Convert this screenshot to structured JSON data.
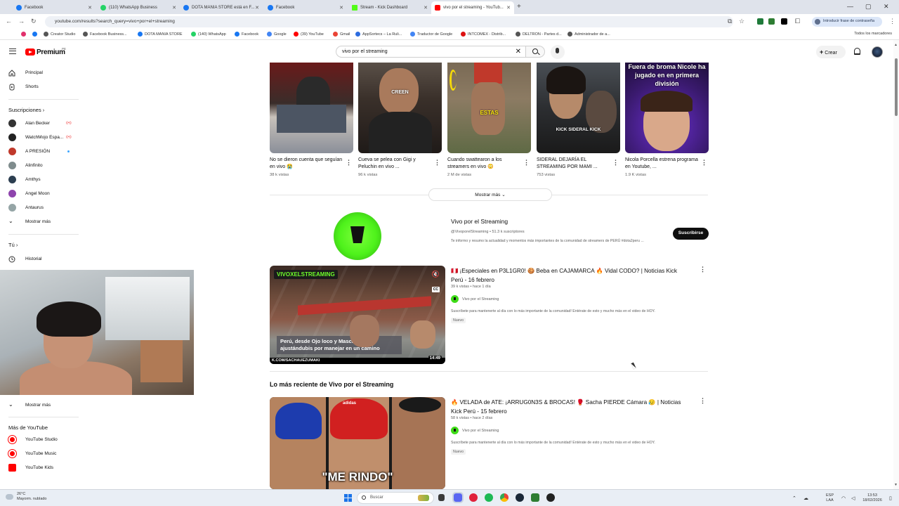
{
  "browser": {
    "tabs": [
      {
        "label": "Facebook",
        "color": "#1877f2"
      },
      {
        "label": "(110) WhatsApp Business",
        "color": "#25d366"
      },
      {
        "label": "DOTA MANIA STORE está en F...",
        "color": "#1877f2"
      },
      {
        "label": "Facebook",
        "color": "#1877f2"
      },
      {
        "label": "Stream - Kick Dashboard",
        "color": "#53fc18"
      },
      {
        "label": "vivo por el streaming - YouTub...",
        "color": "#ff0000",
        "active": true
      }
    ],
    "url": "youtube.com/results?search_query=vivo+por+el+streaming",
    "password_prompt": "Introducir frase de contraseña",
    "bookmarks": [
      {
        "label": "",
        "color": "#e1306c"
      },
      {
        "label": "",
        "color": "#1877f2"
      },
      {
        "label": "Creator Studio",
        "color": "#555"
      },
      {
        "label": "Facebook Business...",
        "color": "#555"
      },
      {
        "label": "DOTA MANIA STORE",
        "color": "#1877f2"
      },
      {
        "label": "(140) WhatsApp",
        "color": "#25d366"
      },
      {
        "label": "Facebook",
        "color": "#1877f2"
      },
      {
        "label": "Google",
        "color": "#4285f4"
      },
      {
        "label": "(39) YouTube",
        "color": "#ff0000"
      },
      {
        "label": "Gmail",
        "color": "#ea4335"
      },
      {
        "label": "AppSortecs – La Ruli...",
        "color": "#2d6cdf"
      },
      {
        "label": "Traductor de Google",
        "color": "#4285f4"
      },
      {
        "label": "INTCOMEX - Distrib...",
        "color": "#d11"
      },
      {
        "label": "DELTRON - Partes d...",
        "color": "#555"
      },
      {
        "label": "Administrador de a...",
        "color": "#555"
      }
    ],
    "all_bookmarks": "Todos los marcadores"
  },
  "youtube": {
    "brand": "Premium",
    "country": "PE",
    "search_query": "vivo por el streaming",
    "create_label": "Crear",
    "sidebar": {
      "home": "Principal",
      "shorts": "Shorts",
      "subscriptions_title": "Suscripciones",
      "subscriptions": [
        {
          "name": "Alan Becker",
          "color": "#333",
          "indicator": "live"
        },
        {
          "name": "WatchMojo Espa...",
          "color": "#222",
          "indicator": "live"
        },
        {
          "name": "A PRESIÓN",
          "color": "#c0392b",
          "indicator": "dot"
        },
        {
          "name": "Alinfinito",
          "color": "#7f8c8d",
          "indicator": ""
        },
        {
          "name": "Amthys",
          "color": "#2c3e50",
          "indicator": ""
        },
        {
          "name": "Angel Moon",
          "color": "#8e44ad",
          "indicator": ""
        },
        {
          "name": "Antaurus",
          "color": "#95a5a6",
          "indicator": ""
        }
      ],
      "show_more": "Mostrar más",
      "you_title": "Tú",
      "history": "Historial",
      "show_more_2": "Mostrar más",
      "more_title": "Más de YouTube",
      "more_items": [
        "YouTube Studio",
        "YouTube Music",
        "YouTube Kids"
      ]
    },
    "shorts": [
      {
        "title": "No se dieron cuenta que seguían en vivo 😭",
        "views": "38 k vistas",
        "caption": ""
      },
      {
        "title": "Cueva se pelea con Gigi y Peluchin en vivo ...",
        "views": "96 k vistas",
        "caption": "CREEN"
      },
      {
        "title": "Cuando swattearon a los streamers en vivo 😳",
        "views": "2 M de vistas",
        "caption": "ESTAS"
      },
      {
        "title": "SIDERAL DEJARÍA EL STREAMING POR MAMI ...",
        "views": "753 vistas",
        "caption": "KICK SIDERAL KICK"
      },
      {
        "title": "Nicola Porcella estrena programa en Youtube, ...",
        "views": "1.9 K vistas",
        "caption": "Fuera de broma Nicole ha jugado en en primera división"
      }
    ],
    "show_more_label": "Mostrar más",
    "channel": {
      "name": "Vivo por el Streaming",
      "handle_subs": "@VivoporelStreaming • 51.3 k suscriptores",
      "description": "Te informo y resumo la actualidad y momentos más importantes de la comunidad de streamers de PERÚ #dota2peru ...",
      "subscribe_label": "Suscribirse"
    },
    "video1": {
      "title": "🇵🇪 ¡Especiales en P3L1GR0! 🍪 Beba en CAJAMARCA 🔥 Vidal CODO? | Noticias Kick Perú - 16 febrero",
      "meta": "39 k vistas • hace 1 día",
      "channel": "Vivo por el Streaming",
      "description": "Suscríbete para mantenerte al día con lo más importante de la comunidad! Entérate de esto y mucho más en el video de HOY.",
      "badge": "Nuevo",
      "duration": "14:49",
      "thumb_banner": "VIVOXELSTREAMING",
      "thumb_caption": "Perú, desde Ojo loco y Mascagamp ajustándubis por manejar en un camino",
      "thumb_footer": "K.COM/SACHAUEZUMAKI"
    },
    "section_title": "Lo más reciente de Vivo por el Streaming",
    "video2": {
      "title": "🔥 VELADA de ATE: ¡ARRUG0N3S & BROCAS! 🥊 Sacha PIERDE Cámara 😥 | Noticias Kick Perú - 15 febrero",
      "meta": "58 k vistas • hace 2 días",
      "channel": "Vivo por el Streaming",
      "description": "Suscríbete para mantenerte al día con lo más importante de la comunidad! Entérate de esto y mucho más en el video de HOY.",
      "badge": "Nuevo",
      "thumb_caption": "\"ME RINDO\""
    }
  },
  "taskbar": {
    "weather_temp": "26°C",
    "weather_desc": "Mayorm. nublado",
    "search_placeholder": "Buscar",
    "lang": "ESP",
    "lang2": "LAA",
    "time": "13:53",
    "date": "18/02/2026"
  }
}
